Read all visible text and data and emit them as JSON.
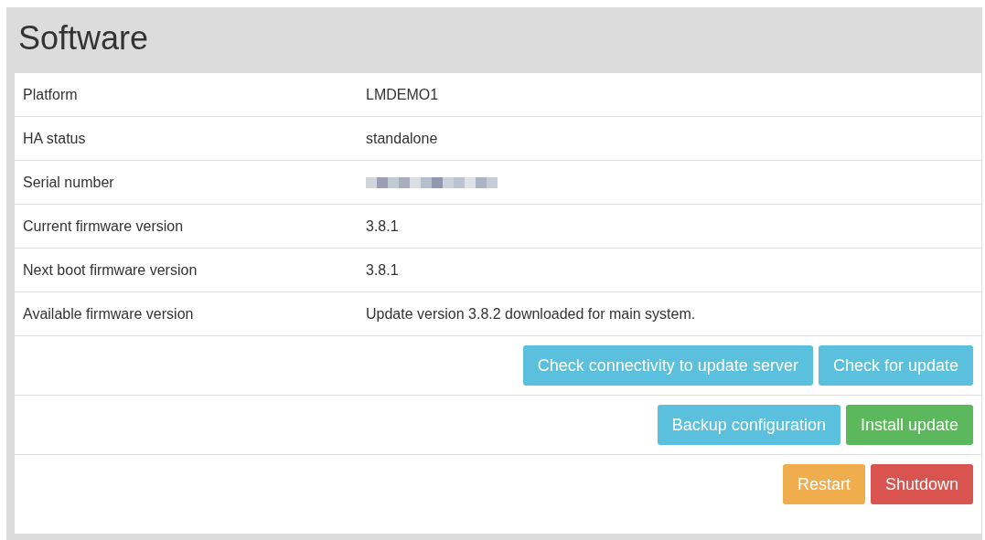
{
  "title": "Software",
  "rows": [
    {
      "label": "Platform",
      "value": "LMDEMO1"
    },
    {
      "label": "HA status",
      "value": "standalone"
    },
    {
      "label": "Serial number",
      "redacted": true
    },
    {
      "label": "Current firmware version",
      "value": "3.8.1"
    },
    {
      "label": "Next boot firmware version",
      "value": "3.8.1"
    },
    {
      "label": "Available firmware version",
      "value": "Update version 3.8.2 downloaded for main system."
    }
  ],
  "button_rows": [
    [
      {
        "label": "Check connectivity to update server",
        "kind": "info"
      },
      {
        "label": "Check for update",
        "kind": "info"
      }
    ],
    [
      {
        "label": "Backup configuration",
        "kind": "info"
      },
      {
        "label": "Install update",
        "kind": "success"
      }
    ],
    [
      {
        "label": "Restart",
        "kind": "warning"
      },
      {
        "label": "Shutdown",
        "kind": "danger"
      }
    ]
  ]
}
